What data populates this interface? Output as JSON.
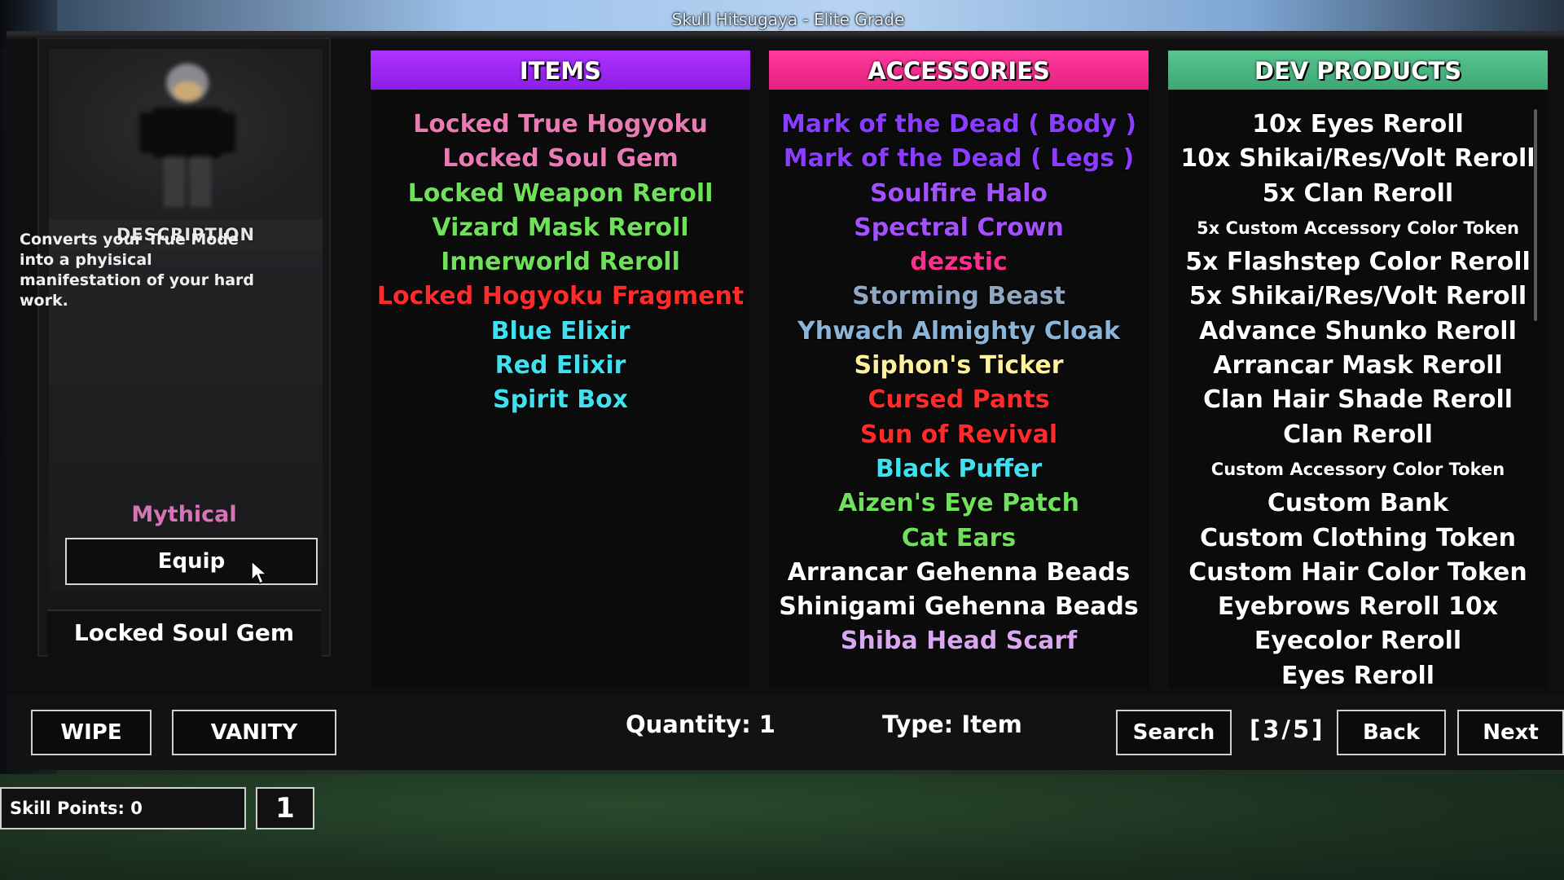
{
  "window": {
    "title": "Skull Hitsugaya - Elite Grade"
  },
  "preview": {
    "description_header": "DESCRIPTION",
    "description": "Converts your True Mode into a phyisical manifestation of your hard work.",
    "rarity": "Mythical",
    "equip_label": "Equip",
    "selected_name": "Locked Soul Gem"
  },
  "columns": {
    "items": {
      "header": "ITEMS",
      "header_color": "#9b28f5",
      "entries": [
        {
          "label": "Locked True Hogyoku",
          "color": "#e87ab4"
        },
        {
          "label": "Locked Soul Gem",
          "color": "#e87ab4"
        },
        {
          "label": "Locked Weapon Reroll",
          "color": "#6ee05a"
        },
        {
          "label": "Vizard Mask Reroll",
          "color": "#6ee05a"
        },
        {
          "label": "Innerworld Reroll",
          "color": "#6ee05a"
        },
        {
          "label": "Locked Hogyoku Fragment",
          "color": "#ff2a2a"
        },
        {
          "label": "Blue Elixir",
          "color": "#3fe0f0"
        },
        {
          "label": "Red Elixir",
          "color": "#3fe0f0"
        },
        {
          "label": "Spirit Box",
          "color": "#3fe0f0"
        }
      ]
    },
    "accessories": {
      "header": "ACCESSORIES",
      "header_color": "#ff2d8c",
      "entries": [
        {
          "label": "Mark of the Dead ( Body )",
          "color": "#8a3cff"
        },
        {
          "label": "Mark of the Dead ( Legs )",
          "color": "#8a3cff"
        },
        {
          "label": "Soulfire Halo",
          "color": "#a450ff"
        },
        {
          "label": "Spectral Crown",
          "color": "#a450ff"
        },
        {
          "label": "dezstic",
          "color": "#ff2d8c"
        },
        {
          "label": "Storming Beast",
          "color": "#8ea6c2"
        },
        {
          "label": "Yhwach Almighty Cloak",
          "color": "#8ab4d8"
        },
        {
          "label": "Siphon's Ticker",
          "color": "#fff09a"
        },
        {
          "label": "Cursed Pants",
          "color": "#ff2a2a"
        },
        {
          "label": "Sun of Revival",
          "color": "#ff2a2a"
        },
        {
          "label": "Black Puffer",
          "color": "#3fe0f0"
        },
        {
          "label": "Aizen's Eye Patch",
          "color": "#6ee05a"
        },
        {
          "label": "Cat Ears",
          "color": "#6ee05a"
        },
        {
          "label": "Arrancar Gehenna Beads",
          "color": "#ffffff"
        },
        {
          "label": "Shinigami Gehenna Beads",
          "color": "#ffffff"
        },
        {
          "label": "Shiba Head Scarf",
          "color": "#d9a6f0"
        }
      ]
    },
    "dev_products": {
      "header": "DEV PRODUCTS",
      "header_color": "#4cb882",
      "entries": [
        {
          "label": "10x Eyes Reroll",
          "small": false
        },
        {
          "label": "10x Shikai/Res/Volt Reroll",
          "small": false
        },
        {
          "label": "5x Clan Reroll",
          "small": false
        },
        {
          "label": "5x Custom Accessory Color Token",
          "small": true
        },
        {
          "label": "5x Flashstep Color Reroll",
          "small": false
        },
        {
          "label": "5x Shikai/Res/Volt Reroll",
          "small": false
        },
        {
          "label": "Advance Shunko Reroll",
          "small": false
        },
        {
          "label": "Arrancar Mask Reroll",
          "small": false
        },
        {
          "label": "Clan Hair Shade Reroll",
          "small": false
        },
        {
          "label": "Clan Reroll",
          "small": false
        },
        {
          "label": "Custom Accessory Color Token",
          "small": true
        },
        {
          "label": "Custom Bank",
          "small": false
        },
        {
          "label": "Custom Clothing Token",
          "small": false
        },
        {
          "label": "Custom Hair Color Token",
          "small": false
        },
        {
          "label": "Eyebrows Reroll 10x",
          "small": false
        },
        {
          "label": "Eyecolor Reroll",
          "small": false
        },
        {
          "label": "Eyes Reroll",
          "small": false
        }
      ]
    }
  },
  "bottom": {
    "wipe_label": "WIPE",
    "vanity_label": "VANITY",
    "quantity": "Quantity: 1",
    "type": "Type: Item",
    "search_label": "Search",
    "page_indicator": "[3/5]",
    "back_label": "Back",
    "next_label": "Next"
  },
  "skill": {
    "points_text": "Skill Points: 0",
    "value": "1"
  }
}
